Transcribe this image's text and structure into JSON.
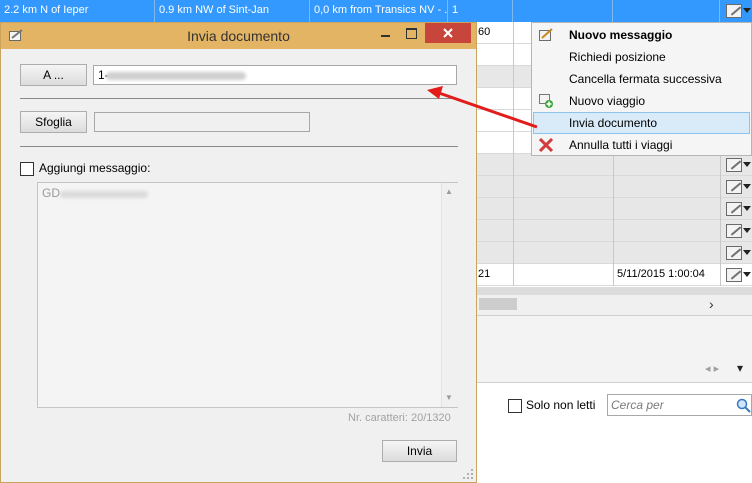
{
  "background_grid": {
    "top_row": {
      "cells": [
        "2.2 km N of Ieper",
        "0.9 km NW of Sint-Jan",
        "0,0 km from Transics NV - ...",
        "1"
      ]
    },
    "row_fragment_60": "60",
    "row_fragment_21": "21",
    "row_datetime": "5/11/2015 1:00:04",
    "scroll_right_glyph": "›",
    "nav_arrows": "◂ ▸",
    "nav_caret": "▾",
    "solo_non_letti_label": "Solo non letti",
    "search_placeholder": "Cerca per"
  },
  "context_menu": {
    "items": [
      {
        "label": "Nuovo messaggio",
        "bold": true,
        "icon": "pen-note-icon"
      },
      {
        "label": "Richiedi posizione",
        "icon": ""
      },
      {
        "label": "Cancella fermata successiva",
        "icon": ""
      },
      {
        "label": "Nuovo viaggio",
        "icon": "add-trip-icon"
      },
      {
        "label": "Invia documento",
        "selected": true,
        "icon": ""
      },
      {
        "label": "Annulla tutti i viaggi",
        "icon": "red-x-icon"
      }
    ]
  },
  "dialog": {
    "title": "Invia documento",
    "to_button": "A ...",
    "to_value": "1-",
    "browse_button": "Sfoglia",
    "browse_value": "",
    "add_message_label": "Aggiungi messaggio:",
    "message_text": "GD",
    "char_count": "Nr. caratteri: 20/1320",
    "send_button": "Invia"
  },
  "colors": {
    "selection_blue": "#3399ff",
    "title_gold": "#e3b463",
    "close_red": "#c7453a",
    "arrow_red": "#e21b1b",
    "menu_highlight": "#d9ebf9"
  }
}
